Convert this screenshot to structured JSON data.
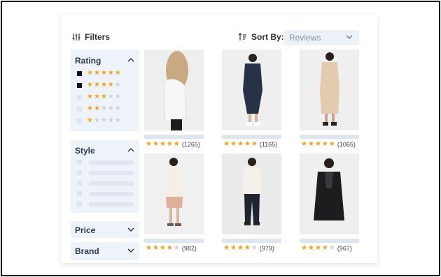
{
  "toolbar": {
    "filters_label": "Filters",
    "sort_label": "Sort By:",
    "sort_value": "Reviews"
  },
  "filters": {
    "rating": {
      "title": "Rating",
      "rows": [
        {
          "checked": true,
          "stars": 5
        },
        {
          "checked": true,
          "stars": 4
        },
        {
          "checked": false,
          "stars": 3
        },
        {
          "checked": false,
          "stars": 2
        },
        {
          "checked": false,
          "stars": 1
        }
      ]
    },
    "style": {
      "title": "Style",
      "rows": 5
    },
    "price": {
      "title": "Price"
    },
    "brand": {
      "title": "Brand"
    }
  },
  "products": [
    {
      "stars": 5,
      "count": "(1265)"
    },
    {
      "stars": 5,
      "count": "(1165)"
    },
    {
      "stars": 5,
      "count": "(1065)"
    },
    {
      "stars": 4,
      "count": "(982)"
    },
    {
      "stars": 4,
      "count": "(979)"
    },
    {
      "stars": 4,
      "count": "(967)"
    }
  ],
  "colors": {
    "star": "#f2a516",
    "star_off": "#c9d1dc",
    "panel": "#eef3fa",
    "text": "#2d3a4a"
  },
  "icons": {
    "filters": "sliders-icon",
    "sort": "sort-icon",
    "chevron": "chevron-icon"
  }
}
